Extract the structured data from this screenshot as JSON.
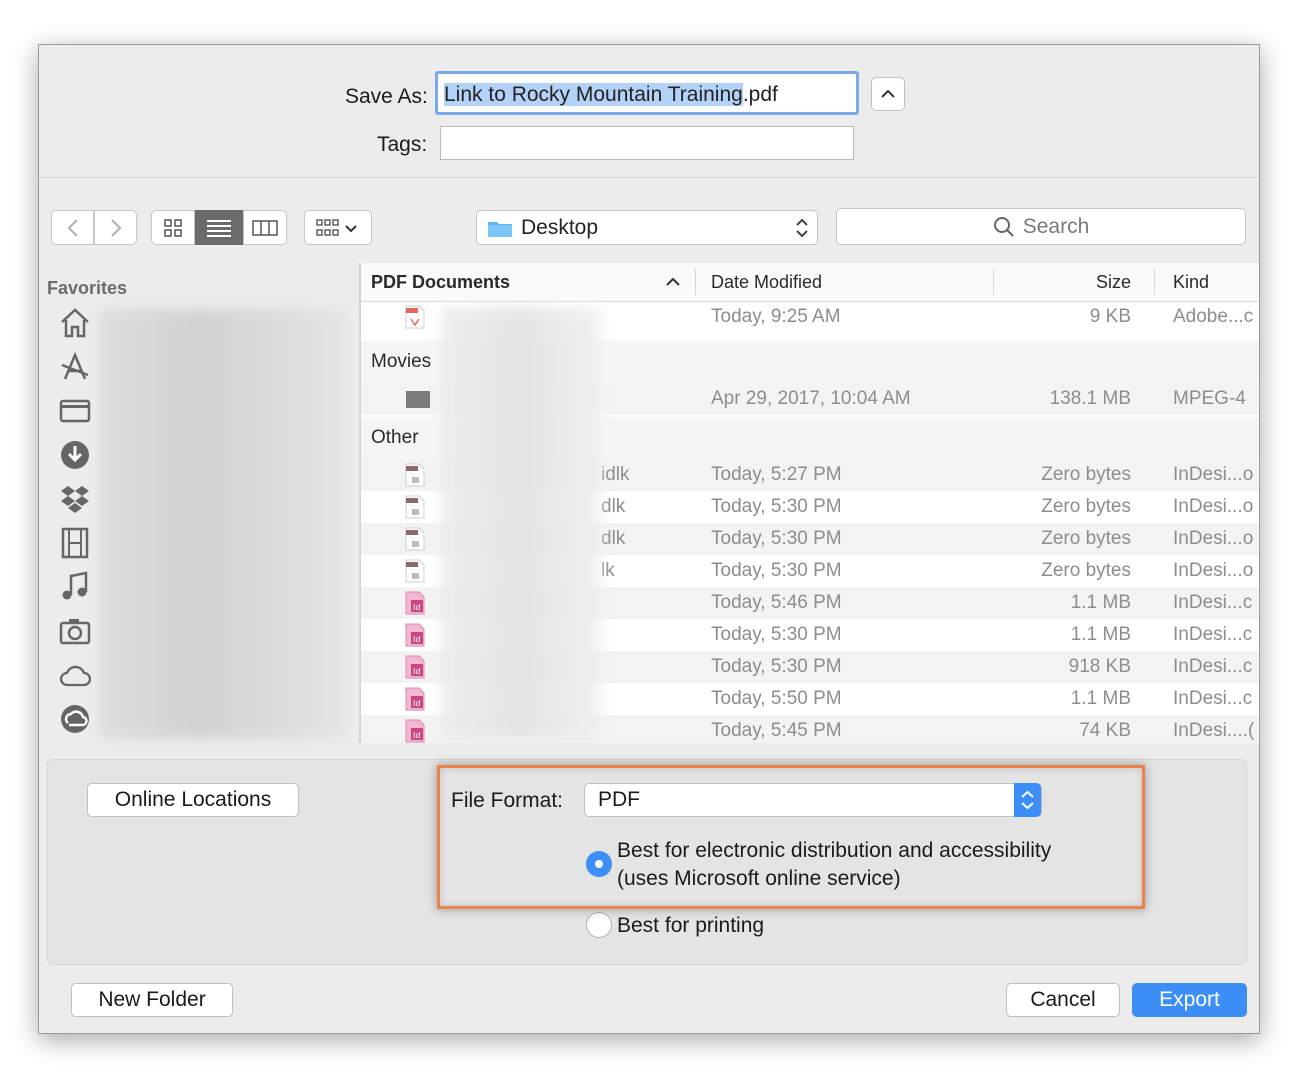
{
  "save_as": {
    "label": "Save As:",
    "value_selected": "Link to Rocky Mountain Training",
    "value_ext": ".pdf"
  },
  "tags": {
    "label": "Tags:",
    "value": ""
  },
  "toolbar": {
    "location": "Desktop",
    "search_placeholder": "Search"
  },
  "sidebar": {
    "heading": "Favorites",
    "icons": [
      "home-icon",
      "applications-icon",
      "desktop-icon",
      "downloads-icon",
      "dropbox-icon",
      "movies-icon",
      "music-icon",
      "pictures-icon",
      "icloud-icon",
      "creative-cloud-icon"
    ]
  },
  "columns": {
    "name": "PDF Documents",
    "date": "Date Modified",
    "size": "Size",
    "kind": "Kind"
  },
  "groups": {
    "movies": "Movies",
    "other": "Other"
  },
  "rows": {
    "pdf": {
      "date": "Today, 9:25 AM",
      "size": "9 KB",
      "kind": "Adobe...c"
    },
    "movie": {
      "date": "Apr 29, 2017, 10:04 AM",
      "size": "138.1 MB",
      "kind": "MPEG-4"
    },
    "other": [
      {
        "name_tail": "idlk",
        "date": "Today, 5:27 PM",
        "size": "Zero bytes",
        "kind": "InDesi...o",
        "icon": "lock"
      },
      {
        "name_tail": "dlk",
        "date": "Today, 5:30 PM",
        "size": "Zero bytes",
        "kind": "InDesi...o",
        "icon": "lock"
      },
      {
        "name_tail": "dlk",
        "date": "Today, 5:30 PM",
        "size": "Zero bytes",
        "kind": "InDesi...o",
        "icon": "lock"
      },
      {
        "name_tail": "lk",
        "date": "Today, 5:30 PM",
        "size": "Zero bytes",
        "kind": "InDesi...o",
        "icon": "lock"
      },
      {
        "name_tail": "",
        "date": "Today, 5:46 PM",
        "size": "1.1 MB",
        "kind": "InDesi...c",
        "icon": "indd"
      },
      {
        "name_tail": "",
        "date": "Today, 5:30 PM",
        "size": "1.1 MB",
        "kind": "InDesi...c",
        "icon": "indd"
      },
      {
        "name_tail": "",
        "date": "Today, 5:30 PM",
        "size": "918 KB",
        "kind": "InDesi...c",
        "icon": "indd"
      },
      {
        "name_tail": "",
        "date": "Today, 5:50 PM",
        "size": "1.1 MB",
        "kind": "InDesi...c",
        "icon": "indd"
      },
      {
        "name_tail": "",
        "date": "Today, 5:45 PM",
        "size": "74 KB",
        "kind": "InDesi....(",
        "icon": "indd"
      }
    ]
  },
  "bottom": {
    "online_locations": "Online Locations",
    "file_format_label": "File Format:",
    "file_format_value": "PDF",
    "option1_line1": "Best for electronic distribution and accessibility",
    "option1_line2": "(uses Microsoft online service)",
    "option2": "Best for printing"
  },
  "footer": {
    "new_folder": "New Folder",
    "cancel": "Cancel",
    "export": "Export"
  },
  "colors": {
    "accent": "#3b8ff7",
    "highlight": "#e9834a"
  }
}
